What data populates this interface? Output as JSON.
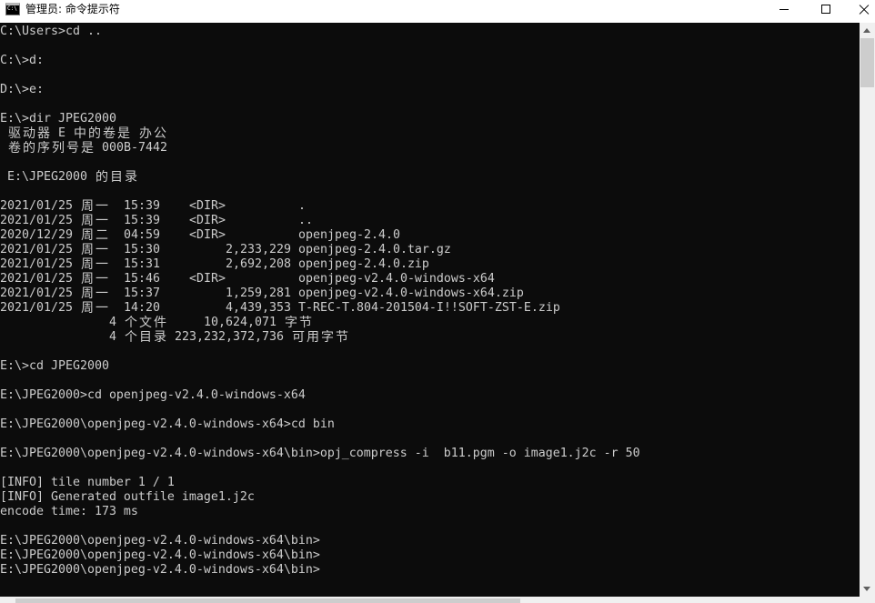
{
  "window": {
    "title": "管理员: 命令提示符",
    "icon_text": "C:\\"
  },
  "icons": {
    "app": "console-icon",
    "minimize": "minimize-icon",
    "maximize": "maximize-icon",
    "close": "close-icon",
    "scroll_up": "scroll-up-arrow-icon",
    "scroll_down": "scroll-down-arrow-icon"
  },
  "colors": {
    "titlebar_bg": "#ffffff",
    "title_text": "#000000",
    "console_bg": "#0c0c0c",
    "console_text": "#cccccc",
    "scrollbar_track": "#f0f0f0",
    "scrollbar_thumb": "#cdcdcd",
    "scrollbar_arrow": "#606060"
  },
  "console": {
    "early_commands": [
      "C:\\Users>cd ..",
      "C:\\>d:",
      "D:\\>e:",
      "E:\\>dir JPEG2000"
    ],
    "volume_info": {
      "label": "驱动器 E 中的卷是 办公",
      "serial": "卷的序列号是 000B-7442"
    },
    "directory_heading": "E:\\JPEG2000 的目录",
    "listing": [
      {
        "date": "2021/01/25",
        "weekday": "周一",
        "time": "15:39",
        "type": "<DIR>",
        "name": "."
      },
      {
        "date": "2021/01/25",
        "weekday": "周一",
        "time": "15:39",
        "type": "<DIR>",
        "name": ".."
      },
      {
        "date": "2020/12/29",
        "weekday": "周二",
        "time": "04:59",
        "type": "<DIR>",
        "name": "openjpeg-2.4.0"
      },
      {
        "date": "2021/01/25",
        "weekday": "周一",
        "time": "15:30",
        "size": "2,233,229",
        "name": "openjpeg-2.4.0.tar.gz"
      },
      {
        "date": "2021/01/25",
        "weekday": "周一",
        "time": "15:31",
        "size": "2,692,208",
        "name": "openjpeg-2.4.0.zip"
      },
      {
        "date": "2021/01/25",
        "weekday": "周一",
        "time": "15:46",
        "type": "<DIR>",
        "name": "openjpeg-v2.4.0-windows-x64"
      },
      {
        "date": "2021/01/25",
        "weekday": "周一",
        "time": "15:37",
        "size": "1,259,281",
        "name": "openjpeg-v2.4.0-windows-x64.zip"
      },
      {
        "date": "2021/01/25",
        "weekday": "周一",
        "time": "14:20",
        "size": "4,439,353",
        "name": "T-REC-T.804-201504-I!!SOFT-ZST-E.zip"
      }
    ],
    "summary": [
      {
        "count": "4",
        "label": "个文件",
        "bytes": "10,624,071",
        "unit": "字节"
      },
      {
        "count": "4",
        "label": "个目录",
        "bytes": "223,232,372,736",
        "unit": "可用字节"
      }
    ],
    "later_commands": [
      "E:\\>cd JPEG2000",
      "E:\\JPEG2000>cd openjpeg-v2.4.0-windows-x64",
      "E:\\JPEG2000\\openjpeg-v2.4.0-windows-x64>cd bin",
      "E:\\JPEG2000\\openjpeg-v2.4.0-windows-x64\\bin>opj_compress -i  b11.pgm -o image1.j2c -r 50"
    ],
    "program_output": [
      "[INFO] tile number 1 / 1",
      "[INFO] Generated outfile image1.j2c",
      "encode time: 173 ms"
    ],
    "current_prompts": [
      "E:\\JPEG2000\\openjpeg-v2.4.0-windows-x64\\bin>",
      "E:\\JPEG2000\\openjpeg-v2.4.0-windows-x64\\bin>",
      "E:\\JPEG2000\\openjpeg-v2.4.0-windows-x64\\bin>"
    ]
  }
}
